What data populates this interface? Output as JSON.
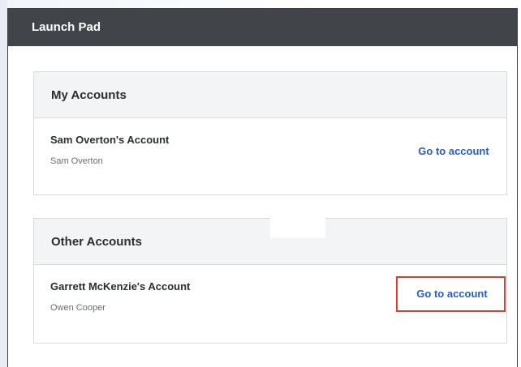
{
  "window": {
    "title": "Launch Pad"
  },
  "my_accounts": {
    "heading": "My Accounts",
    "items": [
      {
        "name": "Sam Overton's Account",
        "owner": "Sam Overton",
        "link_label": "Go to account"
      }
    ]
  },
  "other_accounts": {
    "heading": "Other Accounts",
    "items": [
      {
        "name": "Garrett McKenzie's Account",
        "owner": "Owen Cooper",
        "link_label": "Go to account"
      }
    ]
  },
  "colors": {
    "titlebar": "#414549",
    "link": "#2a5fb0",
    "highlight": "#e03a3a",
    "panel_header_bg": "#f3f4f6"
  }
}
